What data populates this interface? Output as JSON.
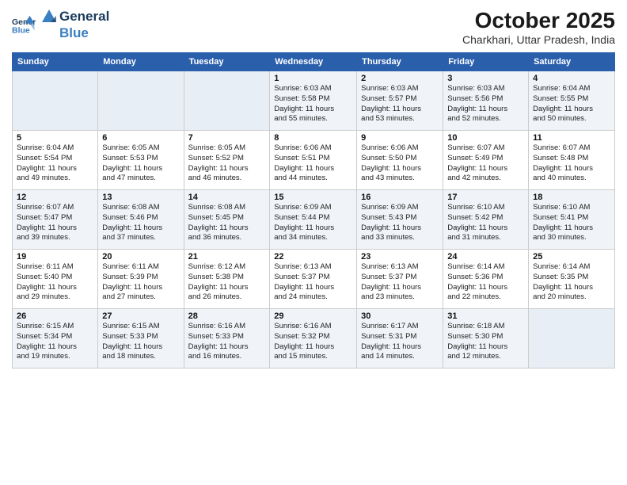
{
  "logo": {
    "line1": "General",
    "line2": "Blue"
  },
  "header": {
    "title": "October 2025",
    "subtitle": "Charkhari, Uttar Pradesh, India"
  },
  "days_of_week": [
    "Sunday",
    "Monday",
    "Tuesday",
    "Wednesday",
    "Thursday",
    "Friday",
    "Saturday"
  ],
  "weeks": [
    [
      {
        "day": "",
        "info": ""
      },
      {
        "day": "",
        "info": ""
      },
      {
        "day": "",
        "info": ""
      },
      {
        "day": "1",
        "info": "Sunrise: 6:03 AM\nSunset: 5:58 PM\nDaylight: 11 hours\nand 55 minutes."
      },
      {
        "day": "2",
        "info": "Sunrise: 6:03 AM\nSunset: 5:57 PM\nDaylight: 11 hours\nand 53 minutes."
      },
      {
        "day": "3",
        "info": "Sunrise: 6:03 AM\nSunset: 5:56 PM\nDaylight: 11 hours\nand 52 minutes."
      },
      {
        "day": "4",
        "info": "Sunrise: 6:04 AM\nSunset: 5:55 PM\nDaylight: 11 hours\nand 50 minutes."
      }
    ],
    [
      {
        "day": "5",
        "info": "Sunrise: 6:04 AM\nSunset: 5:54 PM\nDaylight: 11 hours\nand 49 minutes."
      },
      {
        "day": "6",
        "info": "Sunrise: 6:05 AM\nSunset: 5:53 PM\nDaylight: 11 hours\nand 47 minutes."
      },
      {
        "day": "7",
        "info": "Sunrise: 6:05 AM\nSunset: 5:52 PM\nDaylight: 11 hours\nand 46 minutes."
      },
      {
        "day": "8",
        "info": "Sunrise: 6:06 AM\nSunset: 5:51 PM\nDaylight: 11 hours\nand 44 minutes."
      },
      {
        "day": "9",
        "info": "Sunrise: 6:06 AM\nSunset: 5:50 PM\nDaylight: 11 hours\nand 43 minutes."
      },
      {
        "day": "10",
        "info": "Sunrise: 6:07 AM\nSunset: 5:49 PM\nDaylight: 11 hours\nand 42 minutes."
      },
      {
        "day": "11",
        "info": "Sunrise: 6:07 AM\nSunset: 5:48 PM\nDaylight: 11 hours\nand 40 minutes."
      }
    ],
    [
      {
        "day": "12",
        "info": "Sunrise: 6:07 AM\nSunset: 5:47 PM\nDaylight: 11 hours\nand 39 minutes."
      },
      {
        "day": "13",
        "info": "Sunrise: 6:08 AM\nSunset: 5:46 PM\nDaylight: 11 hours\nand 37 minutes."
      },
      {
        "day": "14",
        "info": "Sunrise: 6:08 AM\nSunset: 5:45 PM\nDaylight: 11 hours\nand 36 minutes."
      },
      {
        "day": "15",
        "info": "Sunrise: 6:09 AM\nSunset: 5:44 PM\nDaylight: 11 hours\nand 34 minutes."
      },
      {
        "day": "16",
        "info": "Sunrise: 6:09 AM\nSunset: 5:43 PM\nDaylight: 11 hours\nand 33 minutes."
      },
      {
        "day": "17",
        "info": "Sunrise: 6:10 AM\nSunset: 5:42 PM\nDaylight: 11 hours\nand 31 minutes."
      },
      {
        "day": "18",
        "info": "Sunrise: 6:10 AM\nSunset: 5:41 PM\nDaylight: 11 hours\nand 30 minutes."
      }
    ],
    [
      {
        "day": "19",
        "info": "Sunrise: 6:11 AM\nSunset: 5:40 PM\nDaylight: 11 hours\nand 29 minutes."
      },
      {
        "day": "20",
        "info": "Sunrise: 6:11 AM\nSunset: 5:39 PM\nDaylight: 11 hours\nand 27 minutes."
      },
      {
        "day": "21",
        "info": "Sunrise: 6:12 AM\nSunset: 5:38 PM\nDaylight: 11 hours\nand 26 minutes."
      },
      {
        "day": "22",
        "info": "Sunrise: 6:13 AM\nSunset: 5:37 PM\nDaylight: 11 hours\nand 24 minutes."
      },
      {
        "day": "23",
        "info": "Sunrise: 6:13 AM\nSunset: 5:37 PM\nDaylight: 11 hours\nand 23 minutes."
      },
      {
        "day": "24",
        "info": "Sunrise: 6:14 AM\nSunset: 5:36 PM\nDaylight: 11 hours\nand 22 minutes."
      },
      {
        "day": "25",
        "info": "Sunrise: 6:14 AM\nSunset: 5:35 PM\nDaylight: 11 hours\nand 20 minutes."
      }
    ],
    [
      {
        "day": "26",
        "info": "Sunrise: 6:15 AM\nSunset: 5:34 PM\nDaylight: 11 hours\nand 19 minutes."
      },
      {
        "day": "27",
        "info": "Sunrise: 6:15 AM\nSunset: 5:33 PM\nDaylight: 11 hours\nand 18 minutes."
      },
      {
        "day": "28",
        "info": "Sunrise: 6:16 AM\nSunset: 5:33 PM\nDaylight: 11 hours\nand 16 minutes."
      },
      {
        "day": "29",
        "info": "Sunrise: 6:16 AM\nSunset: 5:32 PM\nDaylight: 11 hours\nand 15 minutes."
      },
      {
        "day": "30",
        "info": "Sunrise: 6:17 AM\nSunset: 5:31 PM\nDaylight: 11 hours\nand 14 minutes."
      },
      {
        "day": "31",
        "info": "Sunrise: 6:18 AM\nSunset: 5:30 PM\nDaylight: 11 hours\nand 12 minutes."
      },
      {
        "day": "",
        "info": ""
      }
    ]
  ]
}
